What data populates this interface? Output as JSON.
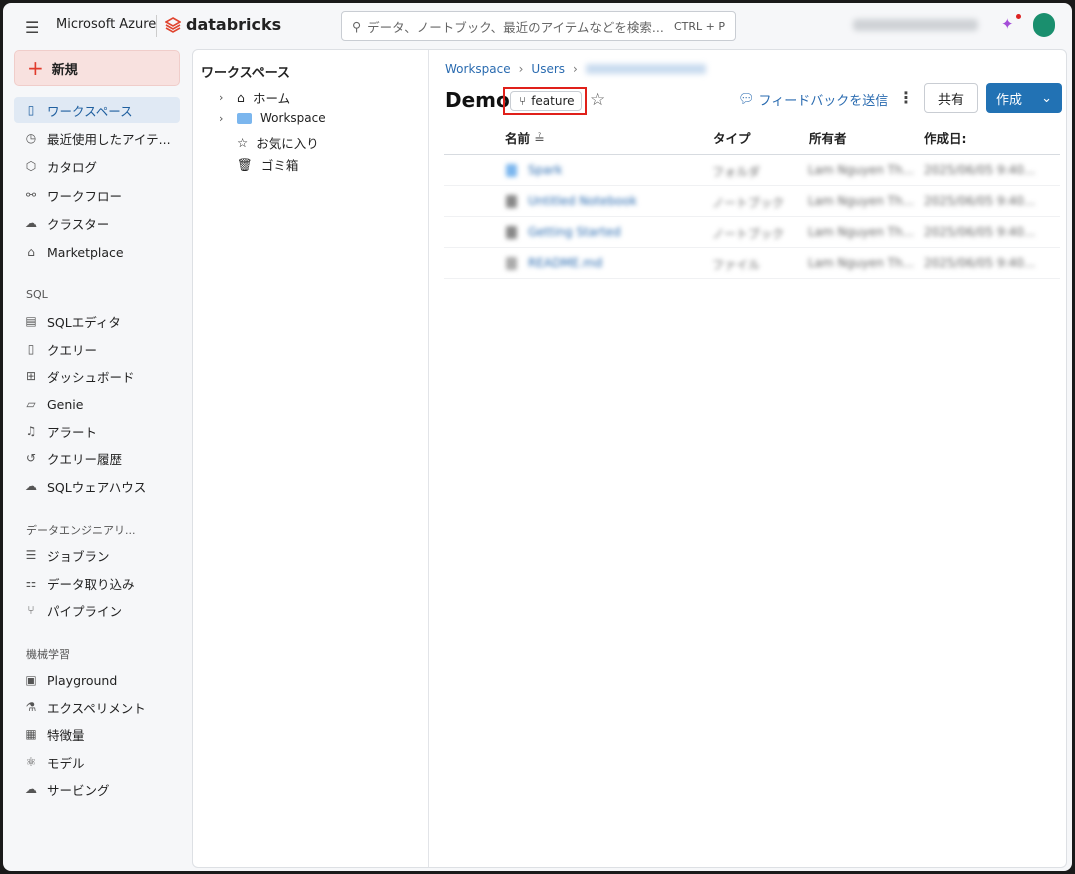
{
  "topbar": {
    "brand": "Microsoft Azure",
    "product": "databricks",
    "search_placeholder": "データ、ノートブック、最近のアイテムなどを検索...",
    "shortcut": "CTRL + P"
  },
  "sidebar": {
    "new_label": "新規",
    "items": [
      {
        "label": "ワークスペース",
        "icon": "workspace-icon"
      },
      {
        "label": "最近使用したアイテ...",
        "icon": "clock-icon"
      },
      {
        "label": "カタログ",
        "icon": "catalog-icon"
      },
      {
        "label": "ワークフロー",
        "icon": "workflow-icon"
      },
      {
        "label": "クラスター",
        "icon": "cloud-icon"
      },
      {
        "label": "Marketplace",
        "icon": "store-icon"
      }
    ],
    "sql_section": "SQL",
    "sql_items": [
      {
        "label": "SQLエディタ"
      },
      {
        "label": "クエリー"
      },
      {
        "label": "ダッシュボード"
      },
      {
        "label": "Genie"
      },
      {
        "label": "アラート"
      },
      {
        "label": "クエリー履歴"
      },
      {
        "label": "SQLウェアハウス"
      }
    ],
    "de_section": "データエンジニアリ...",
    "de_items": [
      {
        "label": "ジョブラン"
      },
      {
        "label": "データ取り込み"
      },
      {
        "label": "パイプライン"
      }
    ],
    "ml_section": "機械学習",
    "ml_items": [
      {
        "label": "Playground"
      },
      {
        "label": "エクスペリメント"
      },
      {
        "label": "特徴量"
      },
      {
        "label": "モデル"
      },
      {
        "label": "サービング"
      }
    ]
  },
  "tree": {
    "title": "ワークスペース",
    "items": [
      {
        "label": "ホーム"
      },
      {
        "label": "Workspace"
      },
      {
        "label": "お気に入り"
      },
      {
        "label": "ゴミ箱"
      }
    ]
  },
  "main": {
    "breadcrumb": [
      "Workspace",
      "Users"
    ],
    "title": "Demo",
    "branch": "feature",
    "feedback": "フィードバックを送信",
    "share": "共有",
    "create": "作成",
    "columns": [
      "名前",
      "タイプ",
      "所有者",
      "作成日:"
    ],
    "rows": [
      {
        "name": "Spark",
        "type": "フォルダ",
        "owner": "Lam Nguyen Th...",
        "date": "2025/06/05 9:40..."
      },
      {
        "name": "Untitled Notebook",
        "type": "ノートブック",
        "owner": "Lam Nguyen Th...",
        "date": "2025/06/05 9:40..."
      },
      {
        "name": "Getting Started",
        "type": "ノートブック",
        "owner": "Lam Nguyen Th...",
        "date": "2025/06/05 9:40..."
      },
      {
        "name": "README.md",
        "type": "ファイル",
        "owner": "Lam Nguyen Th...",
        "date": "2025/06/05 9:40..."
      }
    ]
  },
  "colors": {
    "accent": "#2272b4",
    "highlight": "#e0201a",
    "new_bg": "#f8e1df"
  }
}
